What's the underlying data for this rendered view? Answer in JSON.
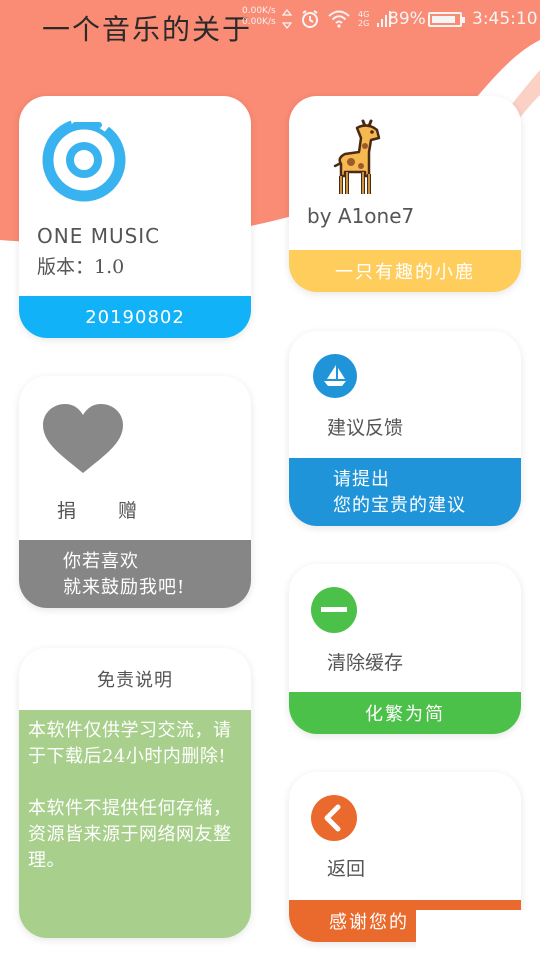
{
  "header": {
    "title": "一个音乐的关于"
  },
  "status_bar": {
    "net_speed_up": "0.00K/s",
    "net_speed_down": "0.00K/s",
    "network_type_1": "4G",
    "network_type_2": "2G",
    "battery_percent": "89%",
    "time": "3:45:10",
    "battery_level": 0.89,
    "icons": [
      "alarm-icon",
      "wifi-icon",
      "signal-icon",
      "battery-icon"
    ]
  },
  "cards": {
    "app_info": {
      "name": "ONE MUSIC",
      "version": "版本：1.0",
      "footer": "20190802",
      "accent": "#12b2f8"
    },
    "author": {
      "by": "by  A1one7",
      "footer": "一只有趣的小鹿",
      "accent": "#fecd5c"
    },
    "donate": {
      "label": "捐  赠",
      "footer_line1": "你若喜欢",
      "footer_line2": "就来鼓励我吧!",
      "accent": "#868686"
    },
    "feedback": {
      "label": "建议反馈",
      "footer_line1": "请提出",
      "footer_line2": "您的宝贵的建议",
      "accent": "#1f94d9"
    },
    "disclaimer": {
      "title": "免责说明",
      "para1": "本软件仅供学习交流，请于下载后24小时内删除!",
      "para2": "本软件不提供任何存储，资源皆来源于网络网友整理。",
      "accent": "#a8cf8c"
    },
    "clear_cache": {
      "label": "清除缓存",
      "footer": "化繁为简",
      "accent": "#4cc14a"
    },
    "back": {
      "label": "返回",
      "footer": "感谢您的",
      "accent": "#ea6a2d"
    }
  }
}
